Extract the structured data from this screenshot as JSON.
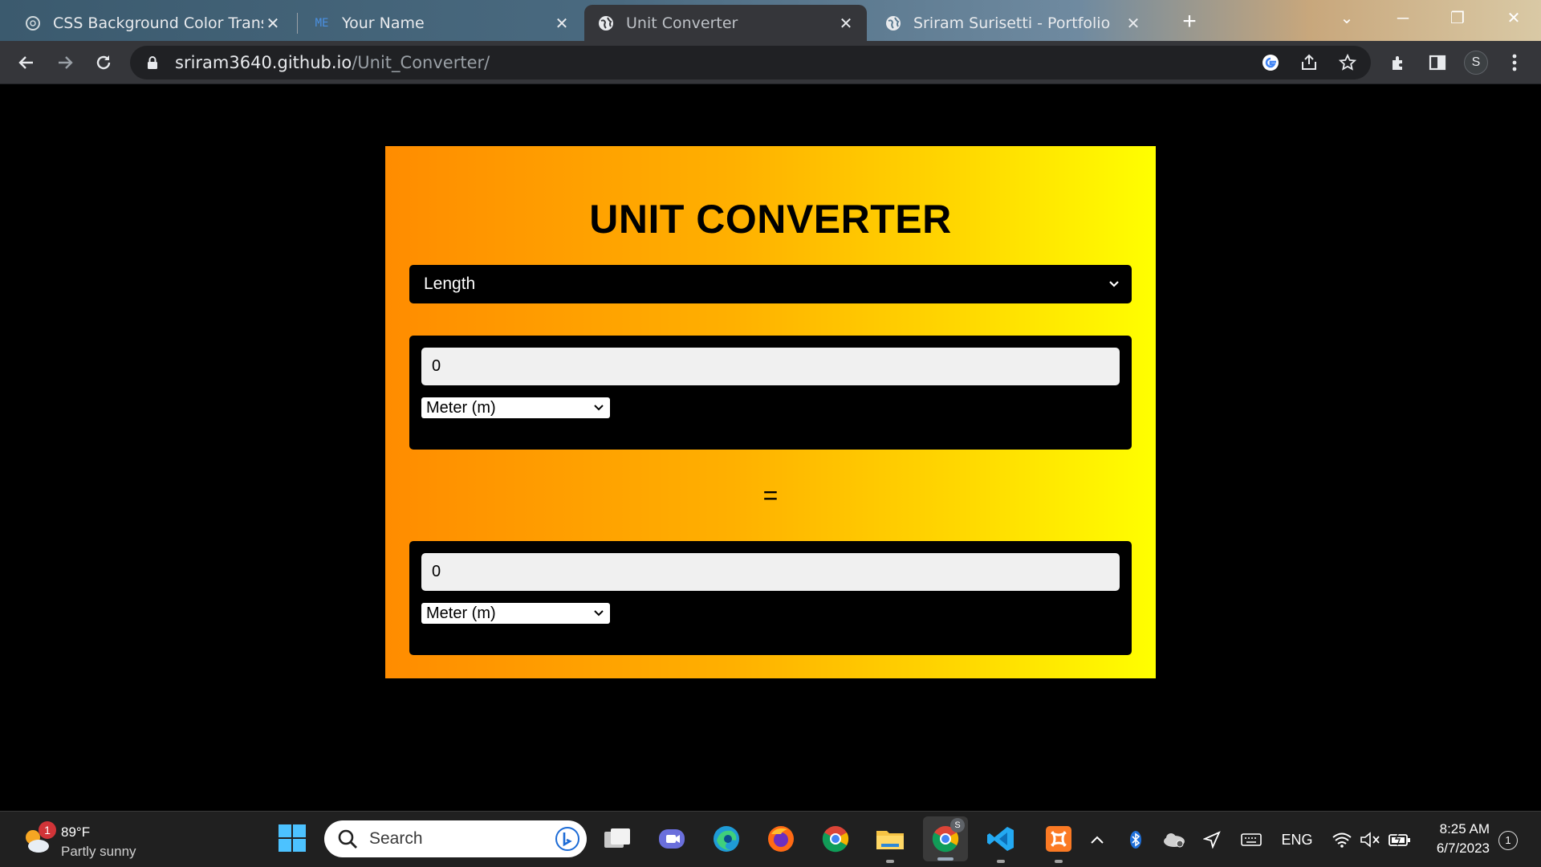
{
  "browser": {
    "tabs": [
      {
        "title": "CSS Background Color Transition",
        "icon": "chatgpt-icon",
        "active": false
      },
      {
        "title": "Your Name",
        "icon": "me-favicon",
        "active": false
      },
      {
        "title": "Unit Converter",
        "icon": "globe-icon",
        "active": true
      },
      {
        "title": "Sriram Surisetti - Portfolio",
        "icon": "globe-icon",
        "active": false
      }
    ],
    "new_tab_symbol": "+",
    "url_host": "sriram3640.github.io",
    "url_path": "/Unit_Converter/",
    "profile_initial": "S",
    "favicon_me_text": "ME"
  },
  "page": {
    "title": "UNIT CONVERTER",
    "type_select_value": "Length",
    "from": {
      "value": "0",
      "unit": "Meter (m)"
    },
    "equals": "=",
    "to": {
      "value": "0",
      "unit": "Meter (m)"
    },
    "colors": {
      "gradient_start": "#ff8c00",
      "gradient_end": "#ffff00",
      "background": "#000000"
    }
  },
  "taskbar": {
    "weather_badge": "1",
    "weather_temp": "89°F",
    "weather_condition": "Partly sunny",
    "search_placeholder": "Search",
    "chrome_profile_badge": "S",
    "language": "ENG",
    "time": "8:25 AM",
    "date": "6/7/2023",
    "notification_count": "1"
  }
}
